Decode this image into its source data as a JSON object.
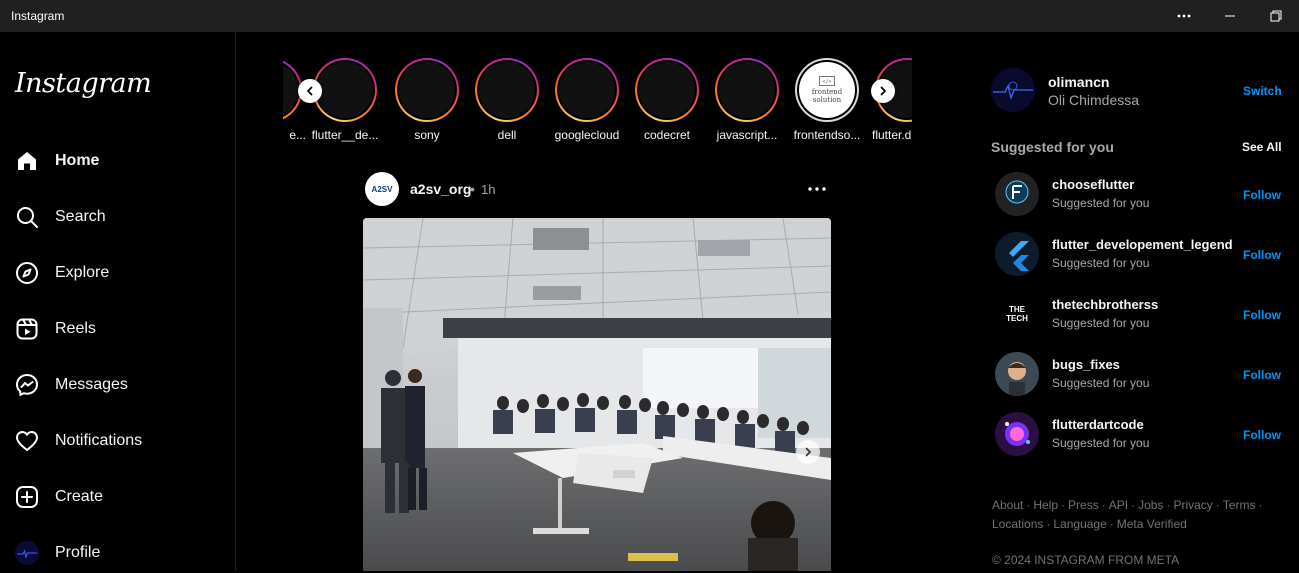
{
  "window": {
    "title": "Instagram"
  },
  "sidebar": {
    "logo": "Instagram",
    "items": [
      {
        "label": "Home",
        "icon": "home-icon"
      },
      {
        "label": "Search",
        "icon": "search-icon"
      },
      {
        "label": "Explore",
        "icon": "compass-icon"
      },
      {
        "label": "Reels",
        "icon": "reels-icon"
      },
      {
        "label": "Messages",
        "icon": "messenger-icon"
      },
      {
        "label": "Notifications",
        "icon": "heart-icon"
      },
      {
        "label": "Create",
        "icon": "plus-square-icon"
      },
      {
        "label": "Profile",
        "icon": "profile-avatar"
      }
    ]
  },
  "stories": [
    {
      "label": "e..."
    },
    {
      "label": "flutter__de..."
    },
    {
      "label": "sony"
    },
    {
      "label": "dell"
    },
    {
      "label": "googlecloud"
    },
    {
      "label": "codecret"
    },
    {
      "label": "javascript..."
    },
    {
      "label": "frontendso..."
    },
    {
      "label": "flutter.d..."
    }
  ],
  "story_avatar_text": "frontend solution",
  "post": {
    "username": "a2sv_org",
    "dot": "•",
    "time": "1h",
    "avatar_text": "A2SV"
  },
  "account": {
    "username": "olimancn",
    "fullname": "Oli Chimdessa",
    "switch_label": "Switch"
  },
  "suggested": {
    "heading": "Suggested for you",
    "see_all": "See All",
    "items": [
      {
        "username": "chooseflutter",
        "sub": "Suggested for you",
        "action": "Follow"
      },
      {
        "username": "flutter_developement_legend",
        "sub": "Suggested for you",
        "action": "Follow"
      },
      {
        "username": "thetechbrotherss",
        "sub": "Suggested for you",
        "action": "Follow"
      },
      {
        "username": "bugs_fixes",
        "sub": "Suggested for you",
        "action": "Follow"
      },
      {
        "username": "flutterdartcode",
        "sub": "Suggested for you",
        "action": "Follow"
      }
    ],
    "avatar_texts": {
      "thetech": "THE TECH"
    }
  },
  "footer": {
    "links": [
      "About",
      "Help",
      "Press",
      "API",
      "Jobs",
      "Privacy",
      "Terms",
      "Locations",
      "Language",
      "Meta Verified"
    ],
    "copyright": "© 2024 INSTAGRAM FROM META"
  },
  "colors": {
    "accent": "#0095f6",
    "background": "#000000",
    "muted": "#a8a8a8"
  }
}
